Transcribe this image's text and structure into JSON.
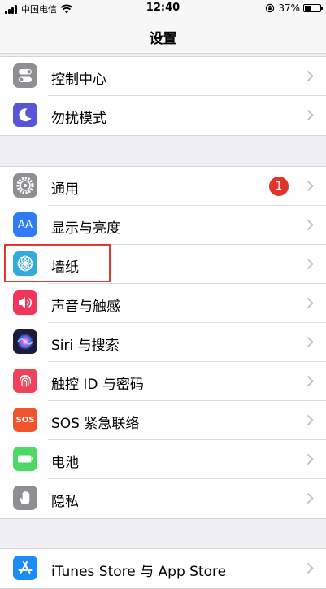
{
  "status": {
    "carrier": "中国电信",
    "time": "12:40",
    "battery": "37%",
    "battery_level": 0.37
  },
  "nav": {
    "title": "设置"
  },
  "groups": [
    {
      "items": [
        {
          "label": "控制中心",
          "icon": "control-center-icon",
          "color": "#8e8e93"
        },
        {
          "label": "勿扰模式",
          "icon": "moon-icon",
          "color": "#5856d6"
        }
      ]
    },
    {
      "items": [
        {
          "label": "通用",
          "icon": "gear-icon",
          "color": "#8e8e93",
          "badge": "1"
        },
        {
          "label": "显示与亮度",
          "icon": "display-icon",
          "color": "#2f7cf6",
          "icon_text": "AA"
        },
        {
          "label": "墙纸",
          "icon": "wallpaper-icon",
          "color": "#34aadc"
        },
        {
          "label": "声音与触感",
          "icon": "speaker-icon",
          "color": "#f0365a"
        },
        {
          "label": "Siri 与搜索",
          "icon": "siri-icon",
          "color": "#1c1c3a"
        },
        {
          "label": "触控 ID 与密码",
          "icon": "fingerprint-icon",
          "color": "#f0435b"
        },
        {
          "label": "SOS 紧急联络",
          "icon": "sos-icon",
          "color": "#f1542c",
          "icon_text": "SOS"
        },
        {
          "label": "电池",
          "icon": "battery-icon",
          "color": "#4cd964"
        },
        {
          "label": "隐私",
          "icon": "hand-icon",
          "color": "#8e8e93"
        }
      ]
    },
    {
      "items": [
        {
          "label": "iTunes Store 与 App Store",
          "icon": "app-store-icon",
          "color": "#1a8cf6"
        }
      ]
    }
  ]
}
